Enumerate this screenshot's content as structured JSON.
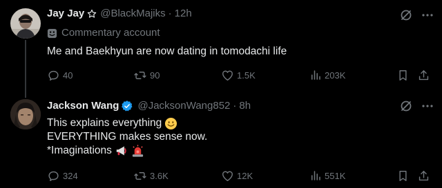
{
  "tweets": [
    {
      "author_name": "Jay Jay",
      "handle": "@BlackMajiks",
      "separator": "·",
      "time": "12h",
      "account_label": "Commentary account",
      "text_lines": [
        "Me and Baekhyun are now dating in tomodachi life"
      ],
      "replies": "40",
      "reposts": "90",
      "likes": "1.5K",
      "views": "203K"
    },
    {
      "author_name": "Jackson Wang",
      "handle": "@JacksonWang852",
      "separator": "·",
      "time": "8h",
      "text_lines": [
        "This explains everything",
        "EVERYTHING makes sense now.",
        "*Imaginations"
      ],
      "replies": "324",
      "reposts": "3.6K",
      "likes": "12K",
      "views": "551K"
    }
  ],
  "colors": {
    "background": "#000000",
    "text_primary": "#e7e9ea",
    "text_secondary": "#71767b",
    "verified": "#1d9bf0",
    "thread_line": "#333639"
  },
  "icons": {
    "verified": "verified-badge-icon",
    "star": "star-outline-icon",
    "commentary": "theater-mask-icon",
    "reply": "reply-bubble-icon",
    "repost": "repost-arrows-icon",
    "like": "heart-outline-icon",
    "views": "views-bars-icon",
    "bookmark": "bookmark-icon",
    "share": "share-arrow-icon",
    "grok": "grok-slash-icon",
    "more": "more-dots-icon",
    "smile": "smiling-face-emoji",
    "megaphone": "megaphone-emoji",
    "siren": "siren-light-emoji"
  }
}
